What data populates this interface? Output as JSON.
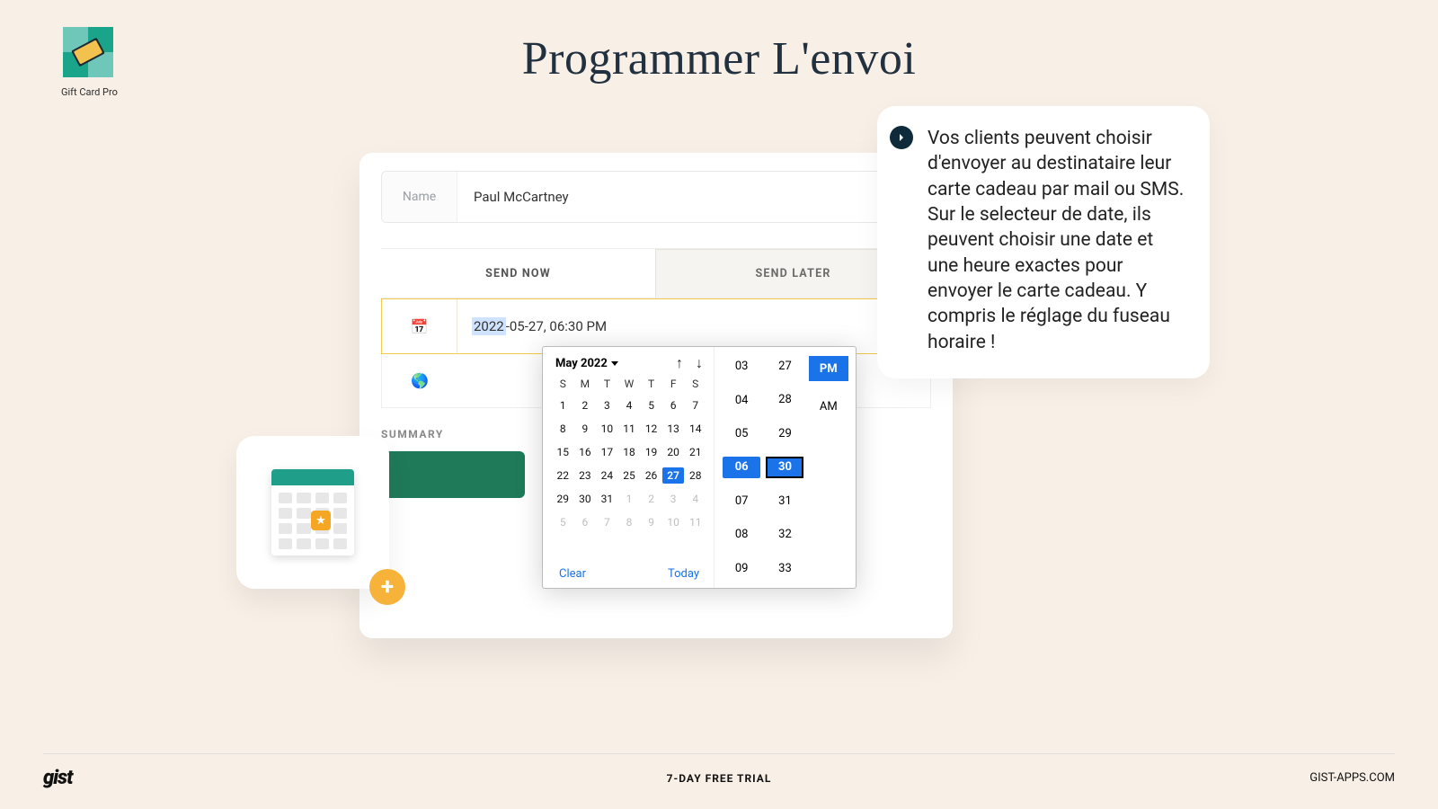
{
  "logo": {
    "label": "Gift Card Pro"
  },
  "heading": "Programmer L'envoi",
  "form": {
    "nameLabel": "Name",
    "nameValue": "Paul McCartney",
    "tabs": {
      "now": "SEND NOW",
      "later": "SEND LATER",
      "active": "later"
    },
    "dateValue": {
      "highlighted": "2022",
      "rest": "-05-27, 06:30 PM"
    },
    "summaryLabel": "SUMMARY"
  },
  "calendar": {
    "monthLabel": "May 2022",
    "daysOfWeek": [
      "S",
      "M",
      "T",
      "W",
      "T",
      "F",
      "S"
    ],
    "weeks": [
      [
        {
          "n": "1"
        },
        {
          "n": "2"
        },
        {
          "n": "3"
        },
        {
          "n": "4"
        },
        {
          "n": "5"
        },
        {
          "n": "6"
        },
        {
          "n": "7"
        }
      ],
      [
        {
          "n": "8"
        },
        {
          "n": "9"
        },
        {
          "n": "10"
        },
        {
          "n": "11"
        },
        {
          "n": "12"
        },
        {
          "n": "13"
        },
        {
          "n": "14"
        }
      ],
      [
        {
          "n": "15"
        },
        {
          "n": "16"
        },
        {
          "n": "17"
        },
        {
          "n": "18"
        },
        {
          "n": "19"
        },
        {
          "n": "20"
        },
        {
          "n": "21"
        }
      ],
      [
        {
          "n": "22"
        },
        {
          "n": "23"
        },
        {
          "n": "24"
        },
        {
          "n": "25"
        },
        {
          "n": "26"
        },
        {
          "n": "27",
          "sel": true
        },
        {
          "n": "28"
        }
      ],
      [
        {
          "n": "29"
        },
        {
          "n": "30"
        },
        {
          "n": "31"
        },
        {
          "n": "1",
          "muted": true
        },
        {
          "n": "2",
          "muted": true
        },
        {
          "n": "3",
          "muted": true
        },
        {
          "n": "4",
          "muted": true
        }
      ],
      [
        {
          "n": "5",
          "muted": true
        },
        {
          "n": "6",
          "muted": true
        },
        {
          "n": "7",
          "muted": true
        },
        {
          "n": "8",
          "muted": true
        },
        {
          "n": "9",
          "muted": true
        },
        {
          "n": "10",
          "muted": true
        },
        {
          "n": "11",
          "muted": true
        }
      ]
    ],
    "clear": "Clear",
    "today": "Today",
    "hours": [
      "03",
      "04",
      "05",
      "06",
      "07",
      "08",
      "09"
    ],
    "minutes": [
      "27",
      "28",
      "29",
      "30",
      "31",
      "32",
      "33"
    ],
    "selectedHour": "06",
    "selectedMinute": "30",
    "ampm": [
      "PM",
      "AM"
    ],
    "selectedAmpm": "PM"
  },
  "callout": {
    "text": "Vos clients peuvent choisir d'envoyer au destinataire leur carte cadeau par mail ou SMS. Sur le selecteur de date, ils peuvent choisir une date et une heure exactes pour envoyer le carte cadeau. Y compris le réglage du fuseau horaire !"
  },
  "footer": {
    "brand": "gist",
    "trial": "7-DAY FREE TRIAL",
    "site": "GIST-APPS.COM"
  }
}
